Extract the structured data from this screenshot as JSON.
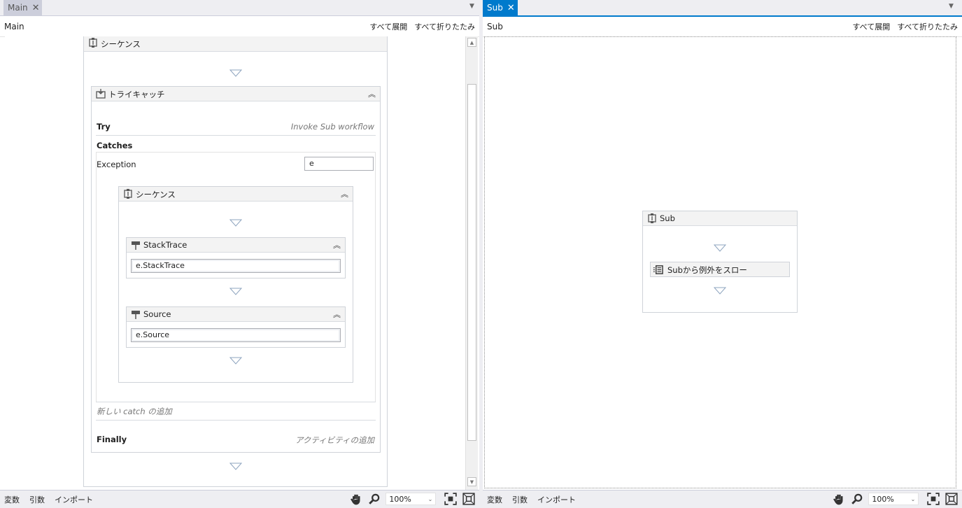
{
  "left": {
    "tab_label": "Main",
    "tab_close": "✕",
    "header_title": "Main",
    "expand_all": "すべて展開",
    "collapse_all": "すべて折りたたみ",
    "outer_sequence": "シーケンス",
    "trycatch": {
      "title": "トライキャッチ",
      "try_label": "Try",
      "try_value": "Invoke Sub workflow",
      "catches_label": "Catches",
      "exception_label": "Exception",
      "exception_var": "e",
      "inner_sequence": "シーケンス",
      "writes": [
        {
          "title": "StackTrace",
          "value": "e.StackTrace"
        },
        {
          "title": "Source",
          "value": "e.Source"
        }
      ],
      "add_catch": "新しい catch の追加",
      "finally_label": "Finally",
      "finally_value": "アクティビティの追加"
    },
    "status_tabs": [
      "変数",
      "引数",
      "インポート"
    ],
    "zoom": "100%"
  },
  "right": {
    "tab_label": "Sub",
    "tab_close": "✕",
    "header_title": "Sub",
    "expand_all": "すべて展開",
    "collapse_all": "すべて折りたたみ",
    "sequence": "Sub",
    "throw_activity": "Subから例外をスロー",
    "status_tabs": [
      "変数",
      "引数",
      "インポート"
    ],
    "zoom": "100%"
  },
  "colors": {
    "accent": "#007acc",
    "inactive_tab": "#cccedb",
    "chrome": "#eeeef2"
  }
}
